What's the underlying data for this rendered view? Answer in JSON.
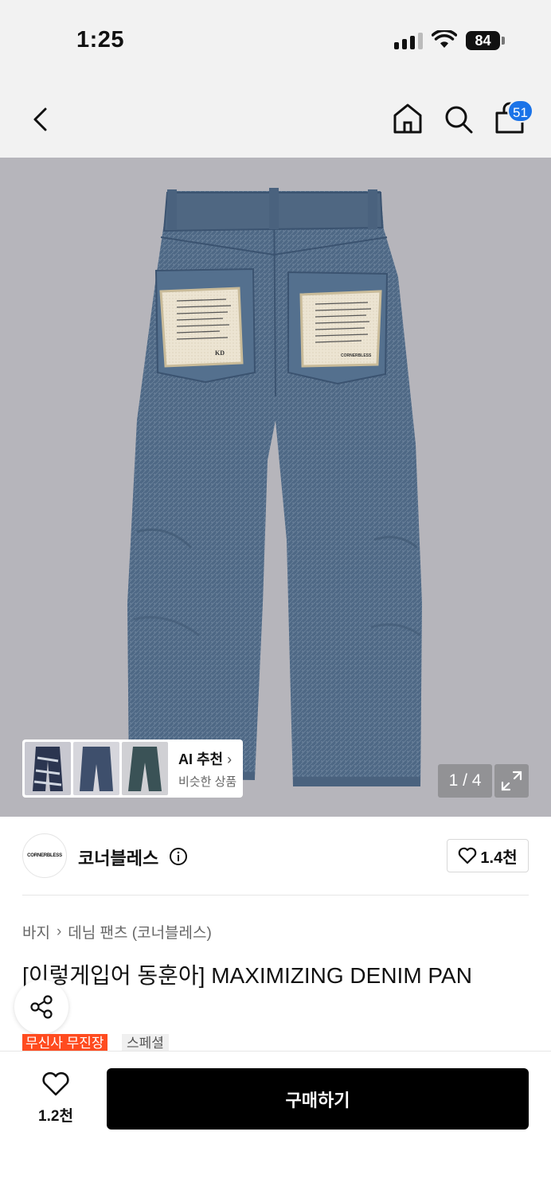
{
  "status": {
    "time": "1:25",
    "battery": "84"
  },
  "nav": {
    "cart_count": "51"
  },
  "product_image": {
    "pager": "1 / 4",
    "pocket_label": "KD",
    "pocket_brand": "CORNERBLESS"
  },
  "ai_recommend": {
    "title": "AI 추천",
    "subtitle": "비슷한 상품"
  },
  "brand": {
    "name": "코너블레스",
    "logo_text": "CORNERBLESS",
    "likes": "1.4천"
  },
  "breadcrumb": {
    "category": "바지",
    "subcategory": "데님 팬츠 (코너블레스)"
  },
  "product": {
    "title": "[이렇게입어 동훈아] MAXIMIZING DENIM PAN",
    "tags": [
      "무신사 무진장",
      "스페셜"
    ]
  },
  "bottom": {
    "likes": "1.2천",
    "buy_label": "구매하기"
  },
  "colors": {
    "accent": "#1a73e8",
    "tag": "#ff4b1f",
    "buy": "#000000"
  }
}
